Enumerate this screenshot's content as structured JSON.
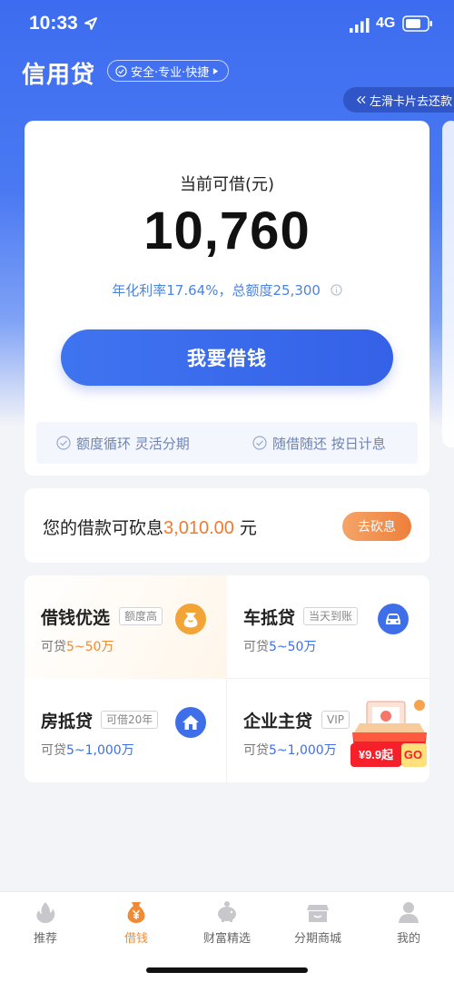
{
  "status_bar": {
    "time": "10:33",
    "network": "4G"
  },
  "header": {
    "title": "信用贷",
    "badge": "安全·专业·快捷",
    "swipe_hint": "左滑卡片去还款"
  },
  "loan_card": {
    "available_label": "当前可借(元)",
    "available_amount": "10,760",
    "rate_text": "年化利率17.64%，总额度25,300",
    "borrow_button": "我要借钱",
    "features": [
      "额度循环 灵活分期",
      "随借随还 按日计息"
    ]
  },
  "bargain": {
    "prefix": "您的借款可砍息",
    "amount": "3,010.00",
    "suffix": " 元",
    "button": "去砍息"
  },
  "products": [
    {
      "name": "借钱优选",
      "tag": "额度高",
      "sub_prefix": "可贷",
      "sub_amount": "5~50万",
      "icon": "money-bag-icon",
      "color": "#f2a437"
    },
    {
      "name": "车抵贷",
      "tag": "当天到账",
      "sub_prefix": "可贷",
      "sub_amount": "5~50万",
      "icon": "car-icon",
      "color": "#3f6fe8"
    },
    {
      "name": "房抵贷",
      "tag": "可借20年",
      "sub_prefix": "可贷",
      "sub_amount": "5~1,000万",
      "icon": "house-icon",
      "color": "#3f6fe8"
    },
    {
      "name": "企业主贷",
      "tag": "VIP",
      "sub_prefix": "可贷",
      "sub_amount": "5~1,000万",
      "icon": "gift-box-icon",
      "color": "#f5202a"
    }
  ],
  "promo": {
    "price": "¥9.9起",
    "go": "GO"
  },
  "bottom_nav": [
    {
      "label": "推荐",
      "icon": "flame-icon",
      "active": false
    },
    {
      "label": "借钱",
      "icon": "yen-bag-icon",
      "active": true
    },
    {
      "label": "财富精选",
      "icon": "piggy-bank-icon",
      "active": false
    },
    {
      "label": "分期商城",
      "icon": "shop-icon",
      "active": false
    },
    {
      "label": "我的",
      "icon": "person-icon",
      "active": false
    }
  ],
  "colors": {
    "brand_blue": "#3d6cf0",
    "accent_orange": "#f07a2f",
    "active_nav": "#f08a34"
  }
}
